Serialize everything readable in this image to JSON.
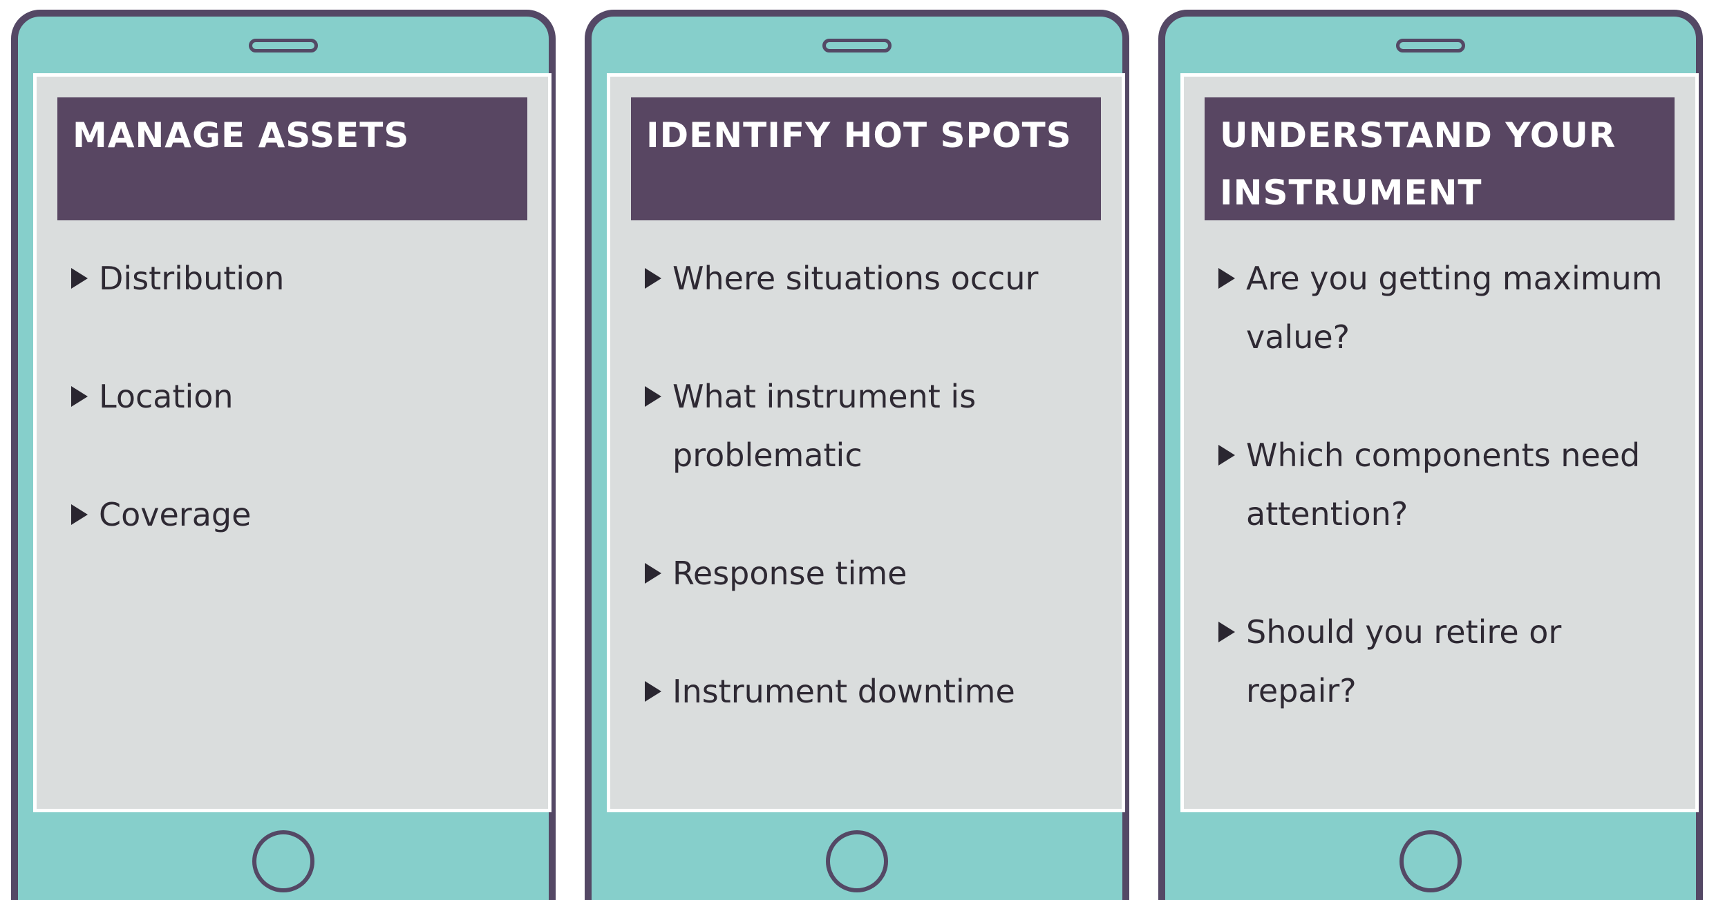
{
  "cards": [
    {
      "title": "MANAGE ASSETS",
      "items": [
        "Distribution",
        "Location",
        "Coverage"
      ]
    },
    {
      "title": "IDENTIFY HOT SPOTS",
      "items": [
        "Where situations occur",
        "What instrument is problematic",
        "Response time",
        "Instrument downtime"
      ]
    },
    {
      "title": "UNDERSTAND YOUR INSTRUMENT",
      "items": [
        "Are you getting maximum value?",
        "Which components need attention?",
        "Should you retire or repair?"
      ]
    }
  ],
  "colors": {
    "phone_body": "#86cfcb",
    "phone_outline": "#544865",
    "screen": "#dadddd",
    "banner": "#584662",
    "banner_text": "#ffffff",
    "item_text": "#2e2933"
  },
  "icons": {
    "bullet": "triangle-right-icon"
  }
}
